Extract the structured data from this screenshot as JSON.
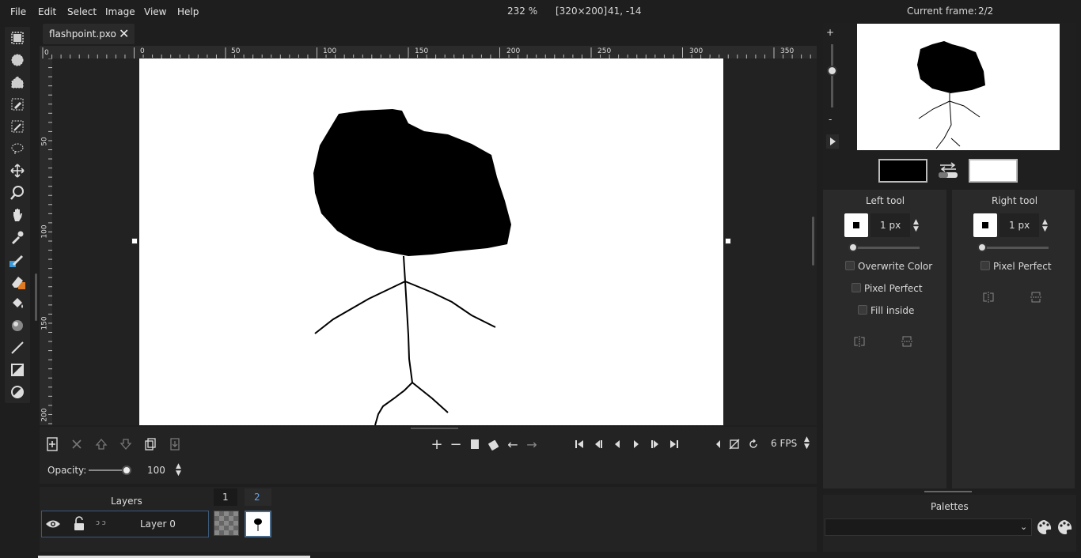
{
  "menu": {
    "file": "File",
    "edit": "Edit",
    "select": "Select",
    "image": "Image",
    "view": "View",
    "help": "Help"
  },
  "status": {
    "zoom": "232 %",
    "size": "[320×200]",
    "coords": "41, -14",
    "current_frame_label": "Current frame:",
    "current_frame_value": "2/2"
  },
  "tab": {
    "name": "flashpoint.pxo",
    "close": "✕"
  },
  "rulers": {
    "h_labels": [
      "0",
      "0",
      "50",
      "100",
      "150",
      "200",
      "250",
      "300",
      "350"
    ],
    "v_labels": [
      "50",
      "100",
      "150",
      "200"
    ]
  },
  "frames": {
    "fps": "6 FPS"
  },
  "opacity": {
    "label": "Opacity:",
    "value": "100",
    "level": 1.0
  },
  "layers": {
    "title": "Layers",
    "frame_numbers": [
      "1",
      "2"
    ],
    "layer_name": "Layer 0"
  },
  "left_tool": {
    "title": "Left tool",
    "size": "1 px",
    "overwrite_color": "Overwrite Color",
    "pixel_perfect": "Pixel Perfect",
    "fill_inside": "Fill inside"
  },
  "right_tool": {
    "title": "Right tool",
    "size": "1 px",
    "pixel_perfect": "Pixel Perfect"
  },
  "palettes": {
    "title": "Palettes"
  },
  "zoom_slider": {
    "plus": "+",
    "minus": "-"
  },
  "colors": {
    "left": "#000000",
    "right": "#ffffff",
    "accent_blue": "#3a9ad9",
    "accent_orange": "#e07b22"
  },
  "icons": [
    "rect-select-icon",
    "ellipse-select-icon",
    "polygon-select-icon",
    "color-select-icon",
    "magic-wand-icon",
    "lasso-icon",
    "move-icon",
    "zoom-icon",
    "pan-icon",
    "color-picker-icon",
    "pencil-icon",
    "eraser-icon",
    "bucket-icon",
    "shading-icon",
    "line-icon",
    "rectangle-icon",
    "ellipse-icon"
  ]
}
